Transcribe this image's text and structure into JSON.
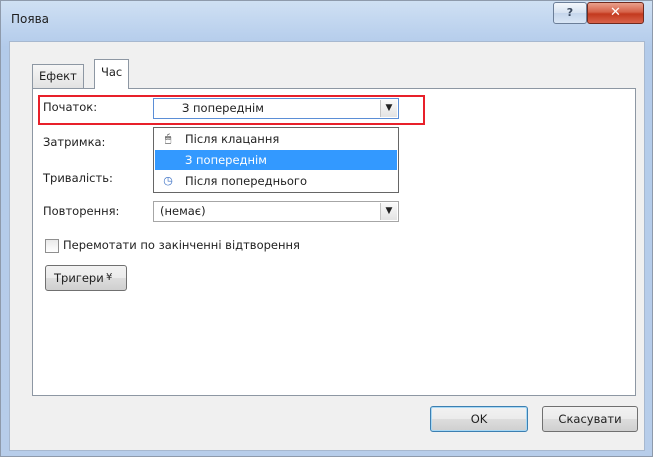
{
  "window": {
    "title": "Поява",
    "help_glyph": "?",
    "close_glyph": "✕"
  },
  "tabs": [
    {
      "label": "Ефект",
      "active": false
    },
    {
      "label": "Час",
      "active": true
    }
  ],
  "fields": {
    "start_label": "Початок:",
    "start_value": "З попереднім",
    "delay_label": "Затримка:",
    "duration_label": "Тривалість:",
    "repeat_label": "Повторення:",
    "repeat_value": "(немає)"
  },
  "dropdown_options": [
    {
      "label": "Після клацання",
      "icon": "mouse-icon",
      "selected": false
    },
    {
      "label": "З попереднім",
      "icon": "",
      "selected": true
    },
    {
      "label": "Після попереднього",
      "icon": "clock-icon",
      "selected": false
    }
  ],
  "checkbox": {
    "label": "Перемотати по закінченні відтворення",
    "checked": false
  },
  "triggers_button": {
    "label": "Тригери",
    "glyph": "¥"
  },
  "buttons": {
    "ok": "OK",
    "cancel": "Скасувати"
  },
  "colors": {
    "highlight": "#e8202a",
    "selection": "#3399ff",
    "close": "#c3391e"
  }
}
